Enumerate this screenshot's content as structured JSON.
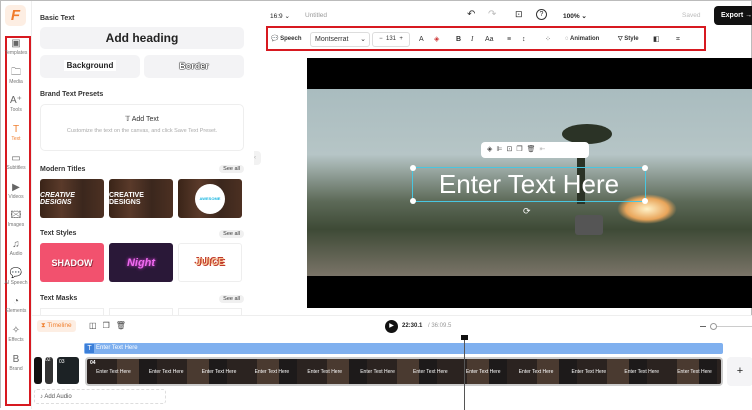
{
  "logo": "F",
  "rail": [
    {
      "label": "Templates",
      "icon": "▣"
    },
    {
      "label": "Media",
      "icon": "🗀"
    },
    {
      "label": "Tools",
      "icon": "A⁺"
    },
    {
      "label": "Text",
      "icon": "T"
    },
    {
      "label": "Subtitles",
      "icon": "▭"
    },
    {
      "label": "Videos",
      "icon": "▶"
    },
    {
      "label": "Images",
      "icon": "🖾"
    },
    {
      "label": "Audio",
      "icon": "♫"
    },
    {
      "label": "AI Speech",
      "icon": "💬"
    },
    {
      "label": "Elements",
      "icon": "◔"
    },
    {
      "label": "Effects",
      "icon": "✧"
    },
    {
      "label": "Brand",
      "icon": "B"
    }
  ],
  "panel": {
    "basic_text": "Basic Text",
    "add_heading": "Add heading",
    "background": "Background",
    "border": "Border",
    "brand_presets": "Brand Text Presets",
    "add_text": "Add Text",
    "preset_hint": "Customize the text on the canvas, and click Save Text Preset.",
    "modern_titles": "Modern Titles",
    "see_all": "See all",
    "mt": [
      "CREATIVE DESIGNS",
      "CREATIVE DESIGNS",
      "AWESOME"
    ],
    "text_styles": "Text Styles",
    "ts": [
      "SHADOW",
      "Night",
      "JUICE"
    ],
    "text_masks": "Text Masks"
  },
  "top": {
    "ratio": "16:9",
    "title": "Untitled",
    "zoom": "100%",
    "saved": "Saved",
    "export": "Export"
  },
  "toolbar": {
    "speech": "Speech",
    "font": "Montserrat",
    "size": "131",
    "animation": "Animation",
    "style": "Style"
  },
  "canvas": {
    "text": "Enter Text Here"
  },
  "timeline": {
    "label": "Timeline",
    "time": "22:30.1",
    "total": "/ 36:09.5",
    "text_clip": "Enter Text Here",
    "clip_numbers": [
      "02",
      "03",
      "04"
    ],
    "frame_caption": "Enter Text Here",
    "add_audio": "Add Audio"
  },
  "colors": {
    "accent": "#f08030",
    "highlight": "#d71920",
    "text_track": "#7fb0ef"
  }
}
